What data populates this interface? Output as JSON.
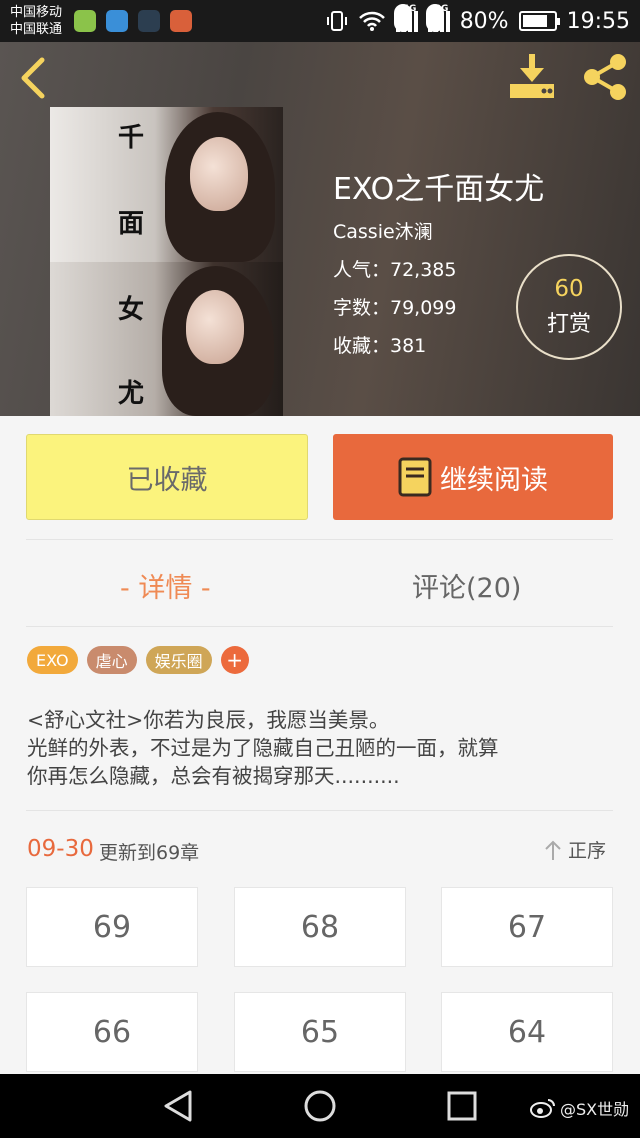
{
  "status_bar": {
    "carrier_1": "中国移动",
    "carrier_2": "中国联通",
    "network_1": "4G",
    "network_2": "3G",
    "battery": "80%",
    "battery_level": 0.8,
    "time": "19:55"
  },
  "cover": {
    "chars": [
      "千",
      "面",
      "女",
      "尤"
    ]
  },
  "book": {
    "title": "EXO之千面女尤",
    "author": "Cassie沐澜",
    "popularity": "人气：72,385",
    "word_count": "字数：79,099",
    "favorites": "收藏：381"
  },
  "reward": {
    "amount": "60",
    "label": "打赏"
  },
  "actions": {
    "collected": "已收藏",
    "continue_reading": "继续阅读"
  },
  "tabs": {
    "detail": "- 详情 -",
    "comments": "评论(20)"
  },
  "tags": [
    {
      "label": "EXO",
      "color": "#f2a93b"
    },
    {
      "label": "虐心",
      "color": "#c98b6d"
    },
    {
      "label": "娱乐圈",
      "color": "#cfa657"
    }
  ],
  "tag_add": "+",
  "description": {
    "line_1": "<舒心文社>你若为良辰，我愿当美景。",
    "line_2": "光鲜的外表，不过是为了隐藏自己丑陋的一面，就算",
    "line_3": "你再怎么隐藏，总会有被揭穿那天.........."
  },
  "update": {
    "date": "09-30",
    "text": "更新到69章",
    "sort_label": "正序"
  },
  "chapters": [
    "69",
    "68",
    "67",
    "66",
    "65",
    "64"
  ],
  "watermark": "@SX世勋",
  "colors": {
    "accent": "#e8693d",
    "collected_bg": "#fbf37d",
    "icon_yellow": "#f5d35e"
  }
}
